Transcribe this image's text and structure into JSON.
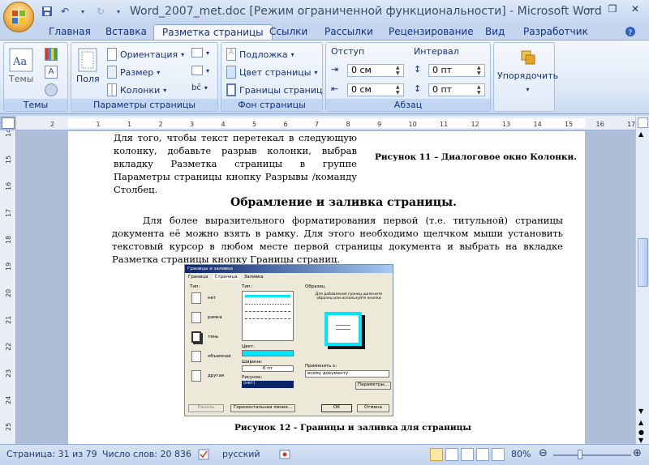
{
  "title": "Word_2007_met.doc [Режим ограниченной функциональности] - Microsoft Word",
  "tabs": [
    "Главная",
    "Вставка",
    "Разметка страницы",
    "Ссылки",
    "Рассылки",
    "Рецензирование",
    "Вид",
    "Разработчик"
  ],
  "ribbon": {
    "themes_label": "Темы",
    "themes_group": "Темы",
    "margins_label": "Поля",
    "orientation": "Ориентация",
    "size": "Размер",
    "columns": "Колонки",
    "page_setup_group": "Параметры страницы",
    "watermark": "Подложка",
    "page_color": "Цвет страницы",
    "page_borders": "Границы страниц",
    "page_bg_group": "Фон страницы",
    "indent_title": "Отступ",
    "indent_left": "0 см",
    "indent_right": "0 см",
    "spacing_title": "Интервал",
    "spacing_before": "0 пт",
    "spacing_after": "0 пт",
    "paragraph_group": "Абзац",
    "arrange": "Упорядочить"
  },
  "ruler_ticks": [
    "2",
    "1",
    "1",
    "2",
    "3",
    "4",
    "5",
    "6",
    "7",
    "8",
    "9",
    "10",
    "11",
    "12",
    "13",
    "14",
    "15",
    "16",
    "17"
  ],
  "vruler_ticks": [
    "14",
    "15",
    "16",
    "17",
    "18",
    "19",
    "20",
    "21",
    "22",
    "23",
    "24",
    "25"
  ],
  "document": {
    "p1": "Для того, чтобы текст перетекал в следующую колонку, добавьте разрыв колонки, выбрав вкладку Разметка страницы в группе Параметры страницы кнопку Разрывы /команду Столбец.",
    "fig11": "Рисунок 11 – Диалоговое окно Колонки.",
    "heading": "Обрамление и заливка страницы.",
    "p2": "Для более выразительного форматирования первой (т.е. титульной) страницы документа её можно взять в рамку. Для этого необходимо щелчком мыши установить текстовый курсор в любом месте первой страницы документа и выбрать на вкладке Разметка страницы кнопку Границы страниц.",
    "fig12": "Рисунок 12 - Границы и заливка для страницы"
  },
  "dialog": {
    "title": "Границы и заливка",
    "tabs": [
      "Граница",
      "Страница",
      "Заливка"
    ],
    "type_label": "Тип:",
    "types": [
      "нет",
      "рамка",
      "тень",
      "объемная",
      "другая"
    ],
    "line_type_label": "Тип:",
    "color_label": "Цвет:",
    "width_label": "Ширина:",
    "width_value": "6 пт",
    "art_label": "Рисунок:",
    "art_value": "(нет)",
    "sample_label": "Образец",
    "sample_hint": "Для добавления границ щелкните образец или используйте кнопки",
    "apply_label": "Применить к:",
    "apply_value": "всему документу",
    "params_button": "Параметры...",
    "print_button": "Панель",
    "hline_button": "Горизонтальная линия...",
    "ok": "ОК",
    "cancel": "Отмена"
  },
  "status": {
    "page": "Страница: 31 из 79",
    "words": "Число слов: 20 836",
    "language": "русский",
    "zoom": "80%"
  },
  "colors": {
    "accent": "#15317e",
    "ribbon": "#dfe9f6",
    "cyan": "#00e5ff"
  }
}
